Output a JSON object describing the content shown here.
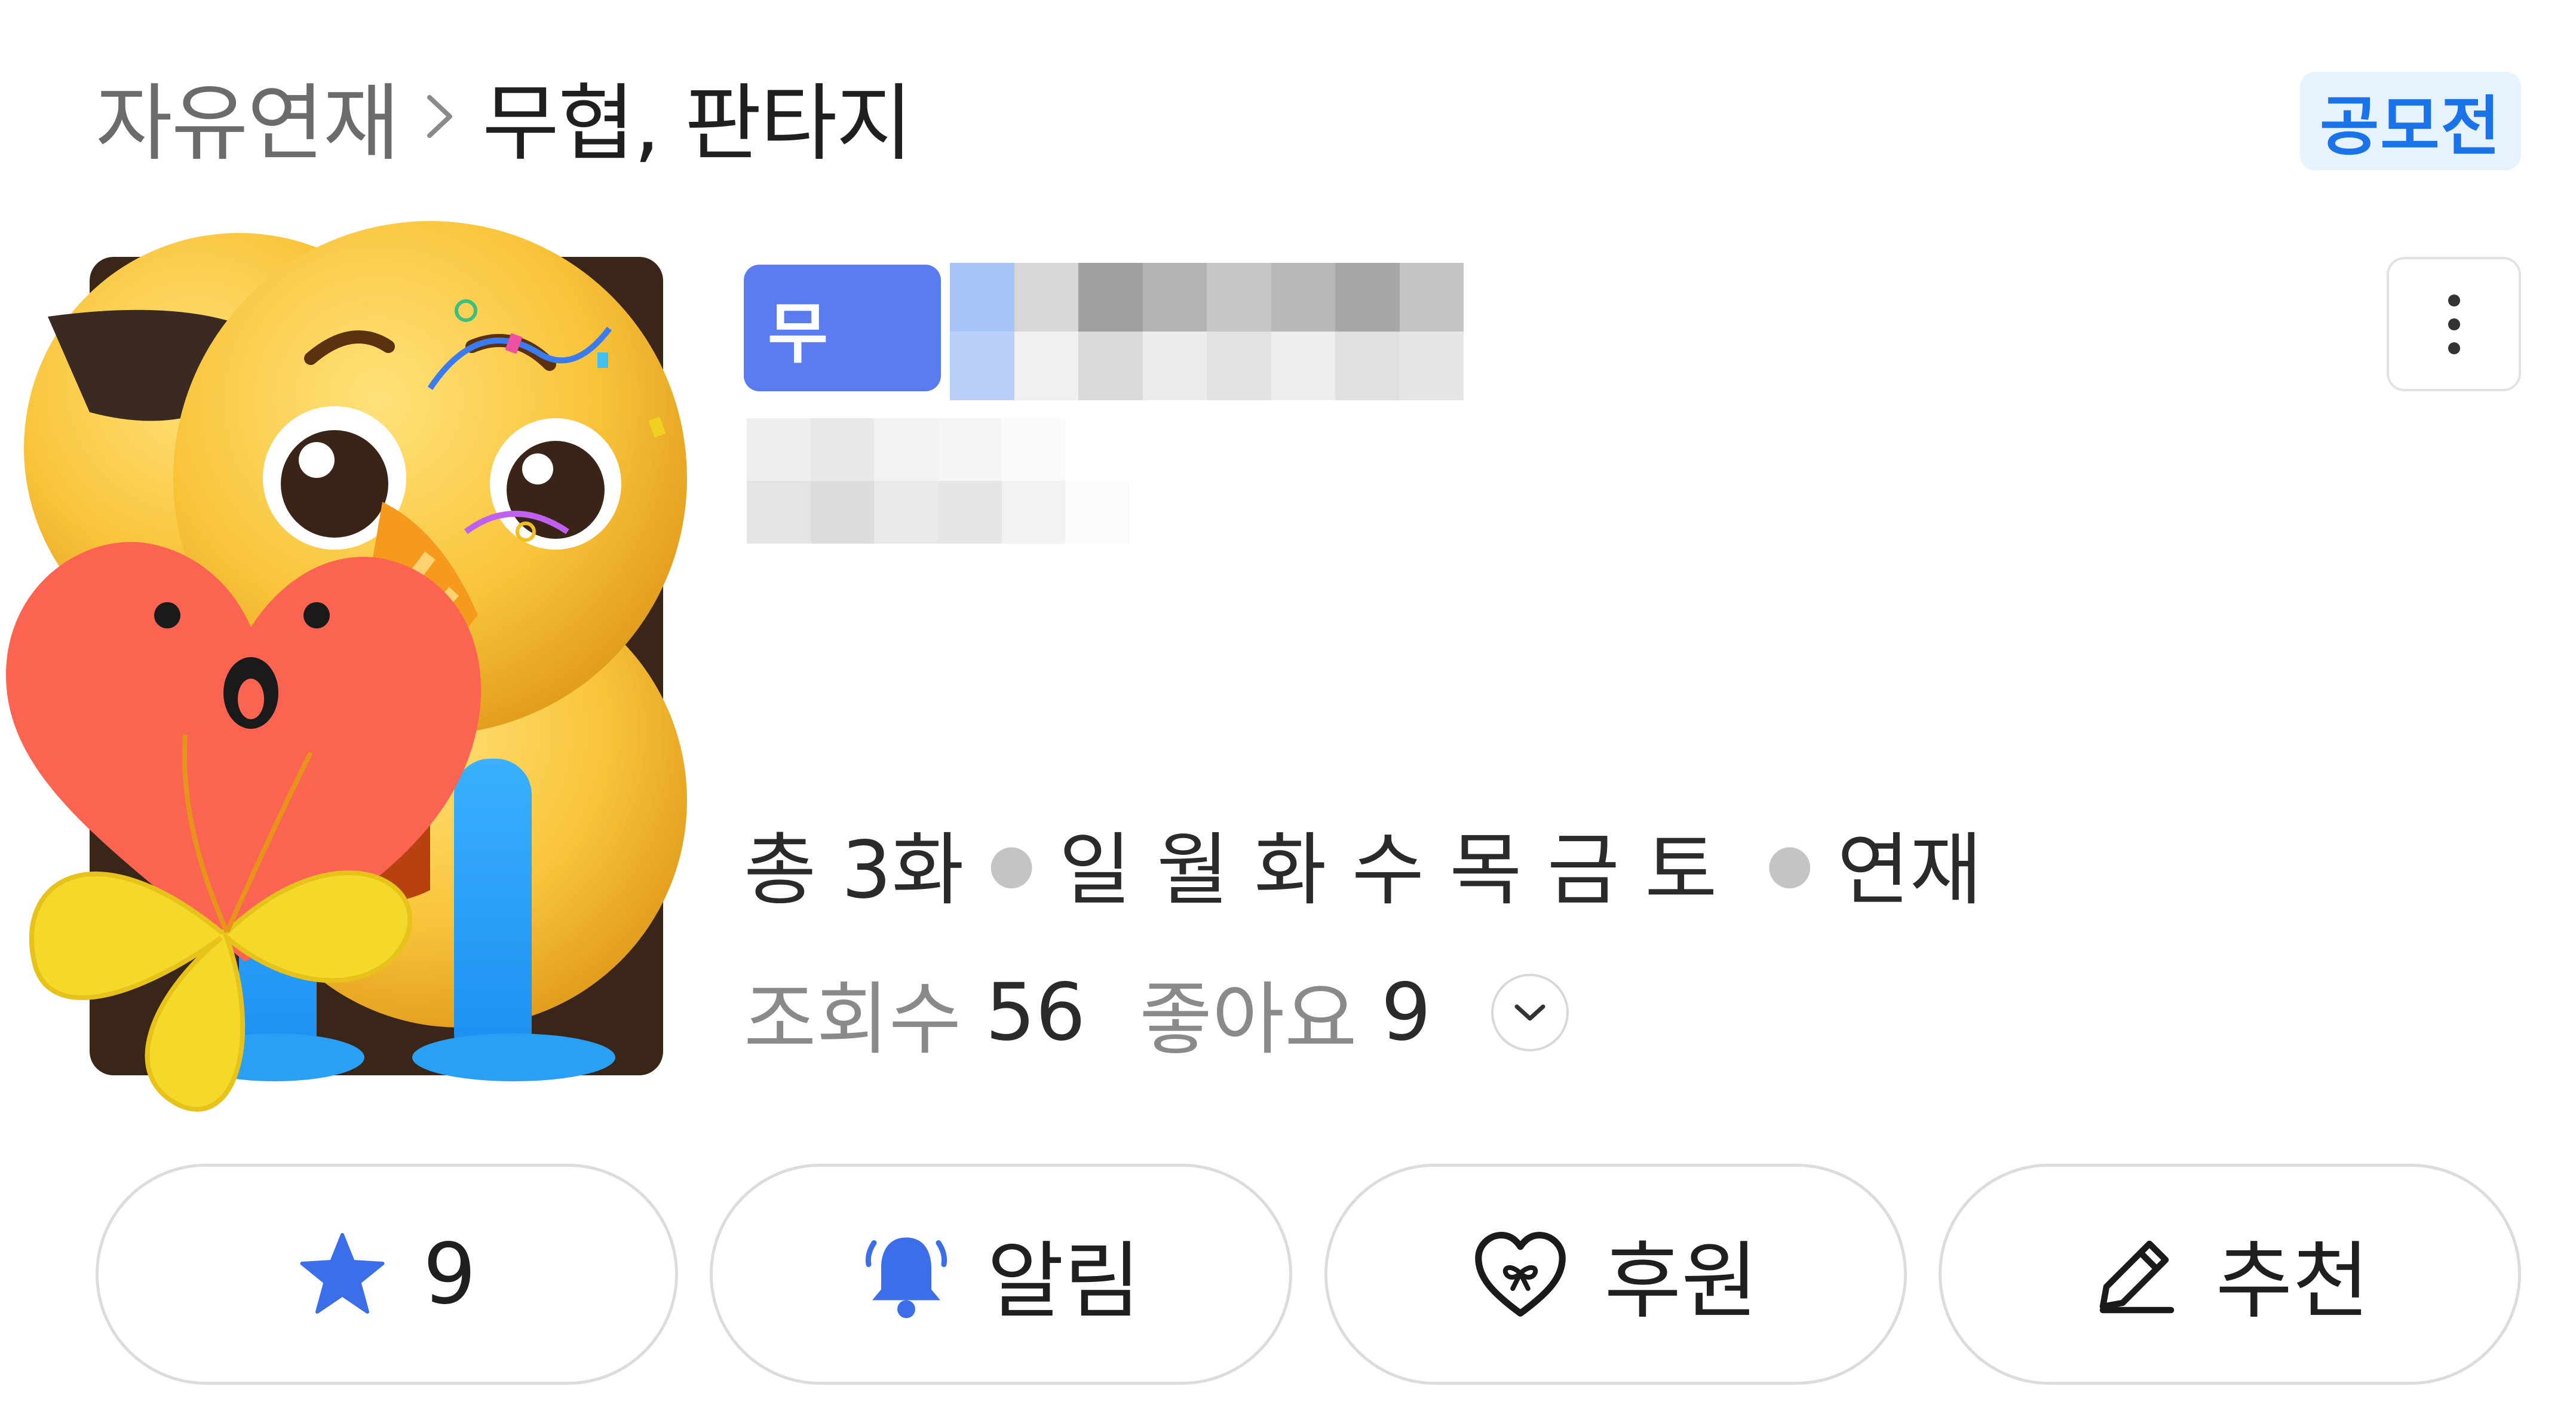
{
  "breadcrumb": {
    "parent": "자유연재",
    "current": "무협, 판타지"
  },
  "contest_badge": "공모전",
  "work": {
    "genre_badge": "무"
  },
  "meta": {
    "total": "총 3화",
    "days": [
      "일",
      "월",
      "화",
      "수",
      "목",
      "금",
      "토"
    ],
    "status": "연재"
  },
  "stats": {
    "views_label": "조회수",
    "views_value": "56",
    "likes_label": "좋아요",
    "likes_value": "9"
  },
  "actions": {
    "favorite_count": "9",
    "alarm_label": "알림",
    "support_label": "후원",
    "recommend_label": "추천"
  },
  "colors": {
    "accent": "#1a73e8",
    "badge_bg": "#e6f2fd",
    "genre_badge": "#5a7cf0",
    "icon_blue": "#3b6ee8"
  }
}
